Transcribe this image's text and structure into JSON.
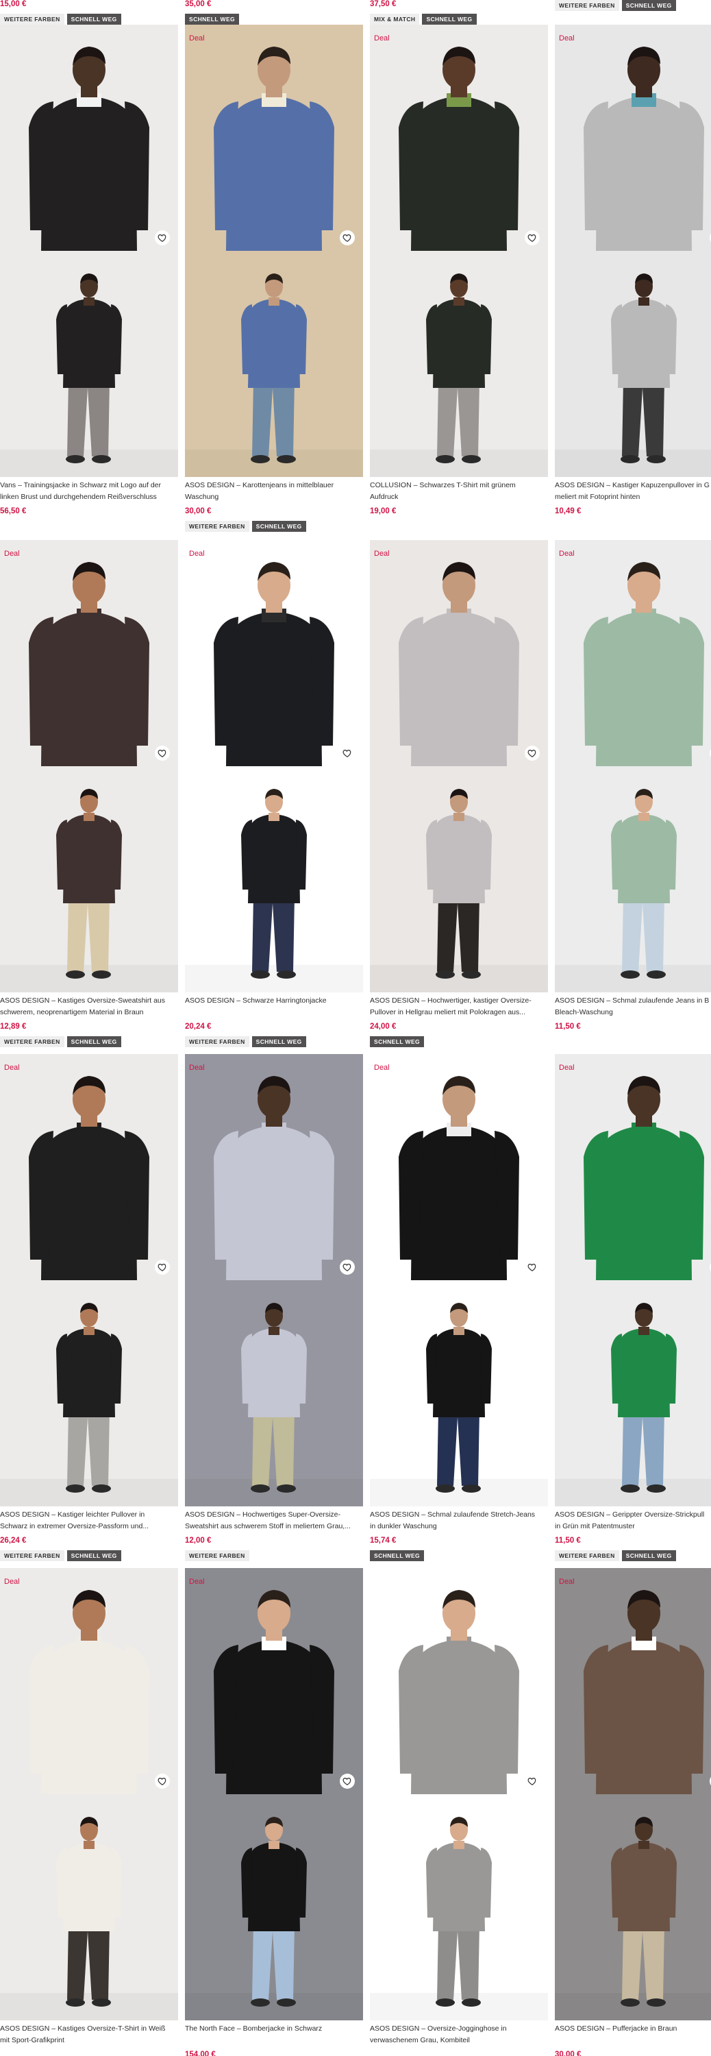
{
  "labels": {
    "deal": "Deal"
  },
  "colors": {
    "price": "#d01345",
    "badge_dark": "#525050",
    "badge_light": "#eeeeee"
  },
  "top_prices": [
    "15,00 €",
    "35,00 €",
    "37,50 €",
    ""
  ],
  "top_badges": [
    [
      "WEITERE FARBEN",
      "SCHNELL WEG"
    ],
    [
      "SCHNELL WEG"
    ],
    [
      "MIX & MATCH",
      "SCHNELL WEG"
    ],
    [
      "WEITERE FARBEN",
      "SCHNELL WEG"
    ]
  ],
  "products": [
    {
      "title1": "Vans – Trainingsjacke in Schwarz mit Logo auf der",
      "title2": "linken Brust und durchgehendem Reißverschluss",
      "price": "56,50 €",
      "badges": [],
      "deal": false,
      "icons": [
        "jacket-photo-icon",
        "jacket-full-photo-icon"
      ]
    },
    {
      "title1": "ASOS DESIGN – Karottenjeans in mittelblauer",
      "title2": "Waschung",
      "price": "30,00 €",
      "badges": [
        "WEITERE FARBEN",
        "SCHNELL WEG"
      ],
      "deal": true,
      "icons": [
        "jeans-photo-icon",
        "jeans-detail-photo-icon"
      ]
    },
    {
      "title1": "COLLUSION – Schwarzes T-Shirt mit grünem",
      "title2": "Aufdruck",
      "price": "19,00 €",
      "badges": [],
      "deal": true,
      "icons": [
        "tshirt-photo-icon",
        "tshirt-full-photo-icon"
      ]
    },
    {
      "title1": "ASOS DESIGN – Kastiger Kapuzenpullover in G",
      "title2": "meliert mit Fotoprint hinten",
      "price": "10,49 €",
      "badges": [],
      "deal": true,
      "icons": [
        "hoodie-back-photo-icon",
        "hoodie-front-photo-icon"
      ]
    },
    {
      "title1": "ASOS DESIGN – Kastiges Oversize-Sweatshirt aus",
      "title2": "schwerem, neoprenartigem Material in Braun",
      "price": "12,89 €",
      "badges": [
        "WEITERE FARBEN",
        "SCHNELL WEG"
      ],
      "deal": true,
      "icons": [
        "sweatshirt-photo-icon",
        "sweatshirt-detail-photo-icon"
      ]
    },
    {
      "title1": "ASOS DESIGN – Schwarze Harringtonjacke",
      "title2": "",
      "price": "20,24 €",
      "badges": [
        "WEITERE FARBEN",
        "SCHNELL WEG"
      ],
      "deal": true,
      "icons": [
        "harrington-photo-icon",
        "harrington-back-photo-icon"
      ]
    },
    {
      "title1": "ASOS DESIGN – Hochwertiger, kastiger Oversize-",
      "title2": "Pullover in Hellgrau meliert mit Polokragen aus...",
      "price": "24,00 €",
      "badges": [
        "SCHNELL WEG"
      ],
      "deal": true,
      "icons": [
        "polo-pullover-photo-icon",
        "polo-pullover-full-photo-icon"
      ]
    },
    {
      "title1": "ASOS DESIGN – Schmal zulaufende Jeans in B",
      "title2": "Bleach-Waschung",
      "price": "11,50 €",
      "badges": [],
      "deal": true,
      "icons": [
        "bleach-jeans-photo-icon",
        "bleach-jeans-side-photo-icon"
      ]
    },
    {
      "title1": "ASOS DESIGN – Kastiger leichter Pullover in",
      "title2": "Schwarz in extremer Oversize-Passform und...",
      "price": "26,24 €",
      "badges": [
        "WEITERE FARBEN",
        "SCHNELL WEG"
      ],
      "deal": true,
      "icons": [
        "black-pullover-photo-icon",
        "black-pullover-detail-photo-icon"
      ]
    },
    {
      "title1": "ASOS DESIGN – Hochwertiges Super-Oversize-",
      "title2": "Sweatshirt aus schwerem Stoff in meliertem Grau,...",
      "price": "12,00 €",
      "badges": [
        "WEITERE FARBEN"
      ],
      "deal": true,
      "icons": [
        "grey-sweatshirt-photo-icon",
        "grey-sweatshirt-back-photo-icon"
      ]
    },
    {
      "title1": "ASOS DESIGN – Schmal zulaufende Stretch-Jeans",
      "title2": "in dunkler Waschung",
      "price": "15,74 €",
      "badges": [
        "SCHNELL WEG"
      ],
      "deal": true,
      "icons": [
        "dark-jeans-photo-icon",
        "dark-jeans-full-photo-icon"
      ]
    },
    {
      "title1": "ASOS DESIGN – Gerippter Oversize-Strickpull",
      "title2": "in Grün mit Patentmuster",
      "price": "11,50 €",
      "badges": [
        "WEITERE FARBEN",
        "SCHNELL WEG"
      ],
      "deal": true,
      "icons": [
        "green-knit-photo-icon",
        "green-knit-full-photo-icon"
      ]
    },
    {
      "title1": "ASOS DESIGN – Kastiges Oversize-T-Shirt in Weiß",
      "title2": "mit Sport-Grafikprint",
      "price": "",
      "badges": [],
      "deal": true,
      "icons": [
        "white-tshirt-photo-icon",
        "white-tshirt-full-photo-icon"
      ]
    },
    {
      "title1": "The North Face – Bomberjacke in Schwarz",
      "title2": "",
      "price": "154,00 €",
      "badges": [],
      "deal": true,
      "icons": [
        "bomber-photo-icon",
        "bomber-couple-photo-icon"
      ]
    },
    {
      "title1": "ASOS DESIGN – Oversize-Jogginghose in",
      "title2": "verwaschenem Grau, Kombiteil",
      "price": "",
      "badges": [],
      "deal": false,
      "icons": [
        "joggers-photo-icon",
        "joggers-full-photo-icon"
      ]
    },
    {
      "title1": "ASOS DESIGN – Pufferjacke in Braun",
      "title2": "",
      "price": "30,00 €",
      "badges": [],
      "deal": true,
      "icons": [
        "puffer-photo-icon",
        "puffer-detail-photo-icon"
      ]
    }
  ]
}
